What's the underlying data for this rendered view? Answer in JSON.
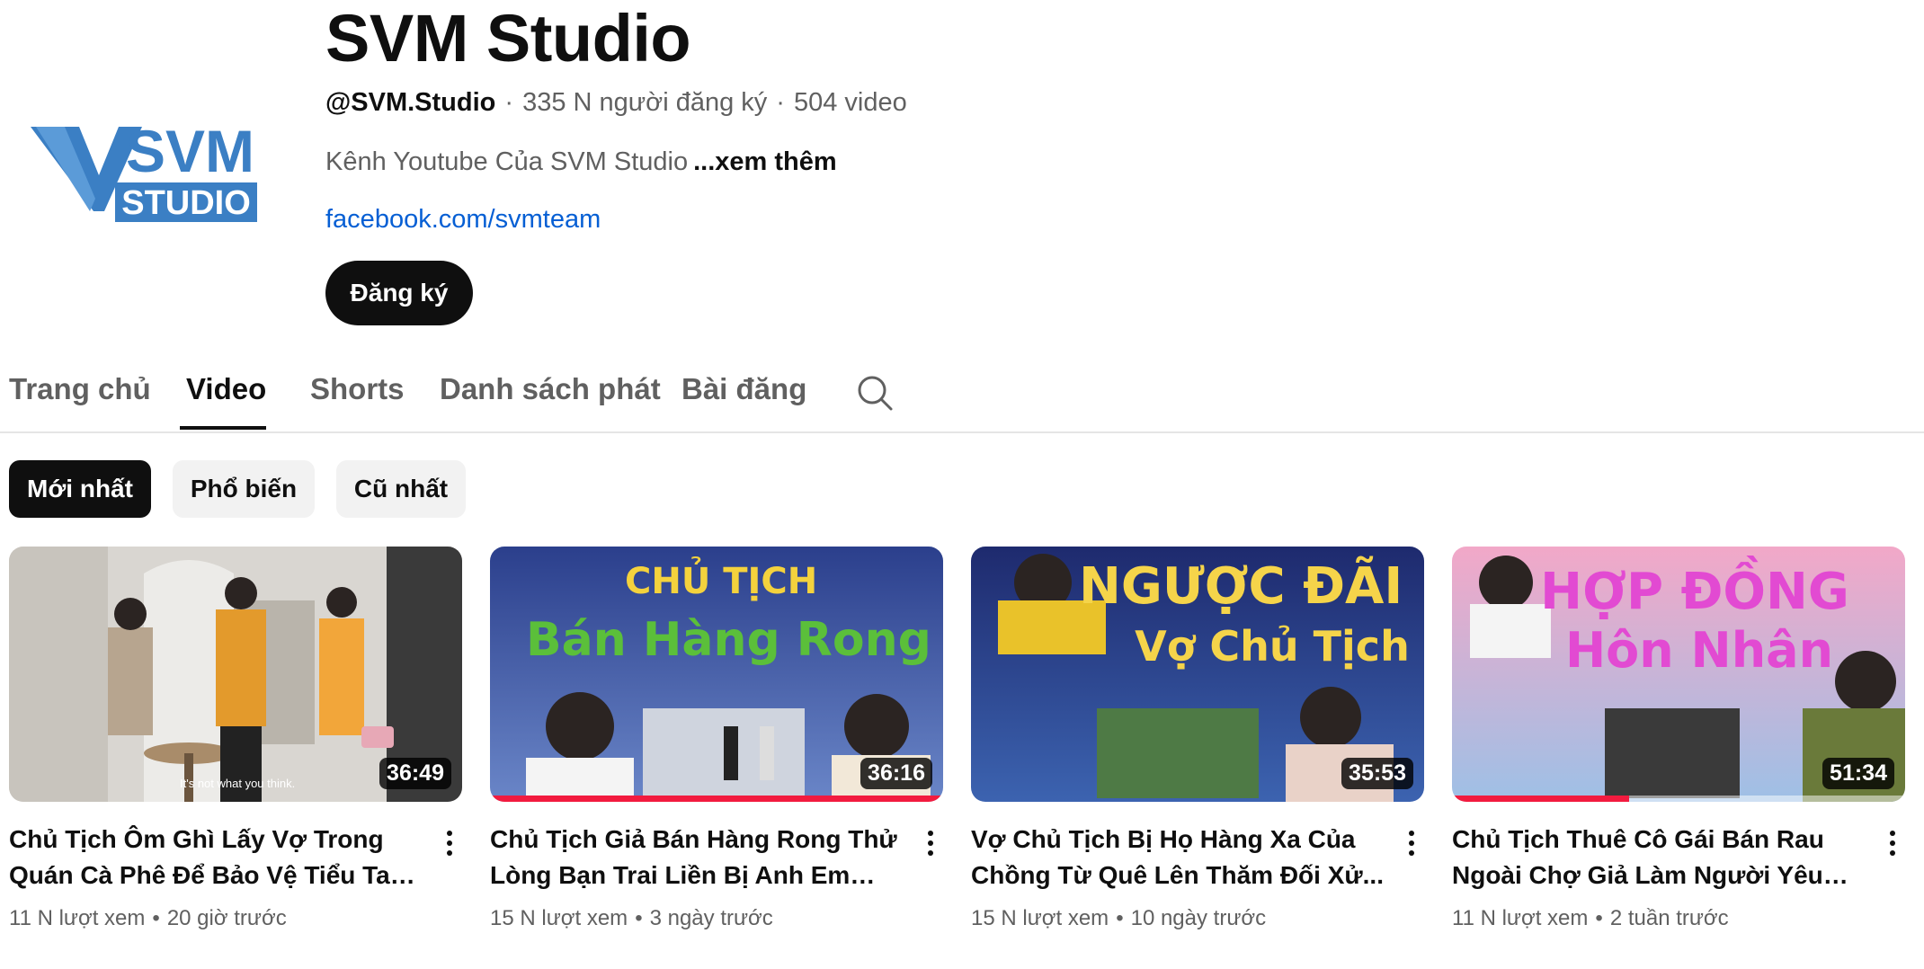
{
  "channel": {
    "name": "SVM Studio",
    "handle": "@SVM.Studio",
    "subscribers": "335 N người đăng ký",
    "video_count": "504 video",
    "description": "Kênh Youtube Của SVM Studio",
    "more_label": "...xem thêm",
    "link": "facebook.com/svmteam",
    "subscribe_label": "Đăng ký",
    "logo_text_top": "SVM",
    "logo_text_bottom": "STUDIO"
  },
  "tabs": [
    {
      "label": "Trang chủ",
      "active": false
    },
    {
      "label": "Video",
      "active": true
    },
    {
      "label": "Shorts",
      "active": false
    },
    {
      "label": "Danh sách phát",
      "active": false
    },
    {
      "label": "Bài đăng",
      "active": false
    }
  ],
  "search_icon": "search-icon",
  "filters": [
    {
      "label": "Mới nhất",
      "active": true
    },
    {
      "label": "Phổ biến",
      "active": false
    },
    {
      "label": "Cũ nhất",
      "active": false
    }
  ],
  "videos": [
    {
      "title": "Chủ Tịch Ôm Ghì Lấy Vợ Trong Quán Cà Phê Để Bảo Vệ Tiểu Tam Khỏi B...",
      "views": "11 N lượt xem",
      "age": "20 giờ trước",
      "duration": "36:49",
      "thumb_text_1": "",
      "thumb_text_2": "",
      "subtitle": "It's not what you think.",
      "watched_fraction": 0
    },
    {
      "title": "Chủ Tịch Giả Bán Hàng Rong Thử Lòng Bạn Trai Liền Bị Anh Em Nhà...",
      "views": "15 N lượt xem",
      "age": "3 ngày trước",
      "duration": "36:16",
      "thumb_text_1": "CHỦ TỊCH",
      "thumb_text_2": "Bán Hàng Rong",
      "subtitle": "",
      "watched_fraction": 1.0
    },
    {
      "title": "Vợ Chủ Tịch Bị Họ Hàng Xa Của Chồng Từ Quê Lên Thăm Đối Xử...",
      "views": "15 N lượt xem",
      "age": "10 ngày trước",
      "duration": "35:53",
      "thumb_text_1": "NGƯỢC ĐÃI",
      "thumb_text_2": "Vợ Chủ Tịch",
      "subtitle": "",
      "watched_fraction": 0
    },
    {
      "title": "Chủ Tịch Thuê Cô Gái Bán Rau Ngoài Chợ Giả Làm Người Yêu Để...",
      "views": "11 N lượt xem",
      "age": "2 tuần trước",
      "duration": "51:34",
      "thumb_text_1": "HỢP ĐỒNG",
      "thumb_text_2": "Hôn Nhân",
      "subtitle": "",
      "watched_fraction": 0.39
    }
  ],
  "colors": {
    "accent": "#f21b3f",
    "link": "#065fd4",
    "logo_blue": "#3b7fc4"
  }
}
